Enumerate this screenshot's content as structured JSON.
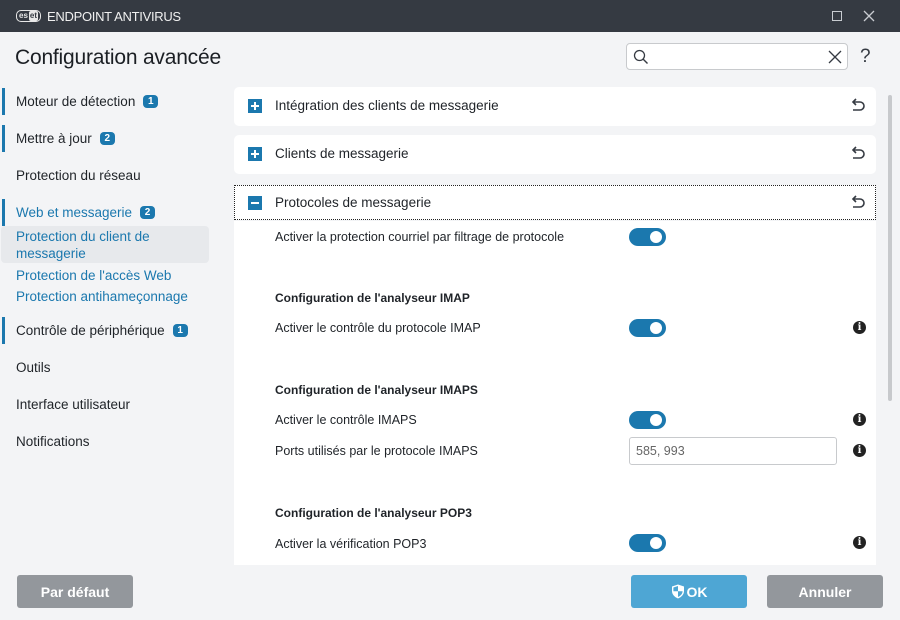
{
  "window": {
    "brand": {
      "logo_left": "es",
      "logo_right": "et"
    },
    "app_title": "ENDPOINT ANTIVIRUS",
    "controls": [
      "maximize-icon",
      "close-icon"
    ]
  },
  "header": {
    "title": "Configuration avancée",
    "search": {
      "value": "",
      "placeholder": ""
    },
    "help_label": "?"
  },
  "sidebar": {
    "items": [
      {
        "label": "Moteur de détection",
        "badge": "1"
      },
      {
        "label": "Mettre à jour",
        "badge": "2"
      },
      {
        "label": "Protection du réseau",
        "badge": ""
      },
      {
        "label": "Web et messagerie",
        "badge": "2"
      },
      {
        "label": "Contrôle de périphérique",
        "badge": "1"
      },
      {
        "label": "Outils",
        "badge": ""
      },
      {
        "label": "Interface utilisateur",
        "badge": ""
      },
      {
        "label": "Notifications",
        "badge": ""
      }
    ],
    "sub_items": [
      {
        "label": "Protection du client de messagerie",
        "selected": true
      },
      {
        "label": "Protection de l'accès Web",
        "selected": false
      },
      {
        "label": "Protection antihameçonnage",
        "selected": false
      }
    ]
  },
  "main": {
    "sections": [
      {
        "label": "Intégration des clients de messagerie",
        "expanded": false
      },
      {
        "label": "Clients de messagerie",
        "expanded": false
      },
      {
        "label": "Protocoles de messagerie",
        "expanded": true
      }
    ],
    "settings": {
      "enable_filtering": {
        "label": "Activer la protection courriel par filtrage de protocole",
        "enabled": true
      },
      "imap_group": "Configuration de l'analyseur IMAP",
      "imap_enable": {
        "label": "Activer le contrôle du protocole IMAP",
        "enabled": true
      },
      "imaps_group": "Configuration de l'analyseur IMAPS",
      "imaps_enable": {
        "label": "Activer le contrôle IMAPS",
        "enabled": true
      },
      "imaps_ports": {
        "label": "Ports utilisés par le protocole IMAPS",
        "value": "585, 993"
      },
      "pop3_group": "Configuration de l'analyseur POP3",
      "pop3_enable": {
        "label": "Activer la vérification POP3",
        "enabled": true
      }
    }
  },
  "footer": {
    "default_label": "Par défaut",
    "ok_label": "OK",
    "cancel_label": "Annuler"
  },
  "colors": {
    "accent": "#1b78ae",
    "titlebar": "#353a42",
    "ok_button": "#4ea6d4",
    "secondary_button": "#93979c"
  }
}
